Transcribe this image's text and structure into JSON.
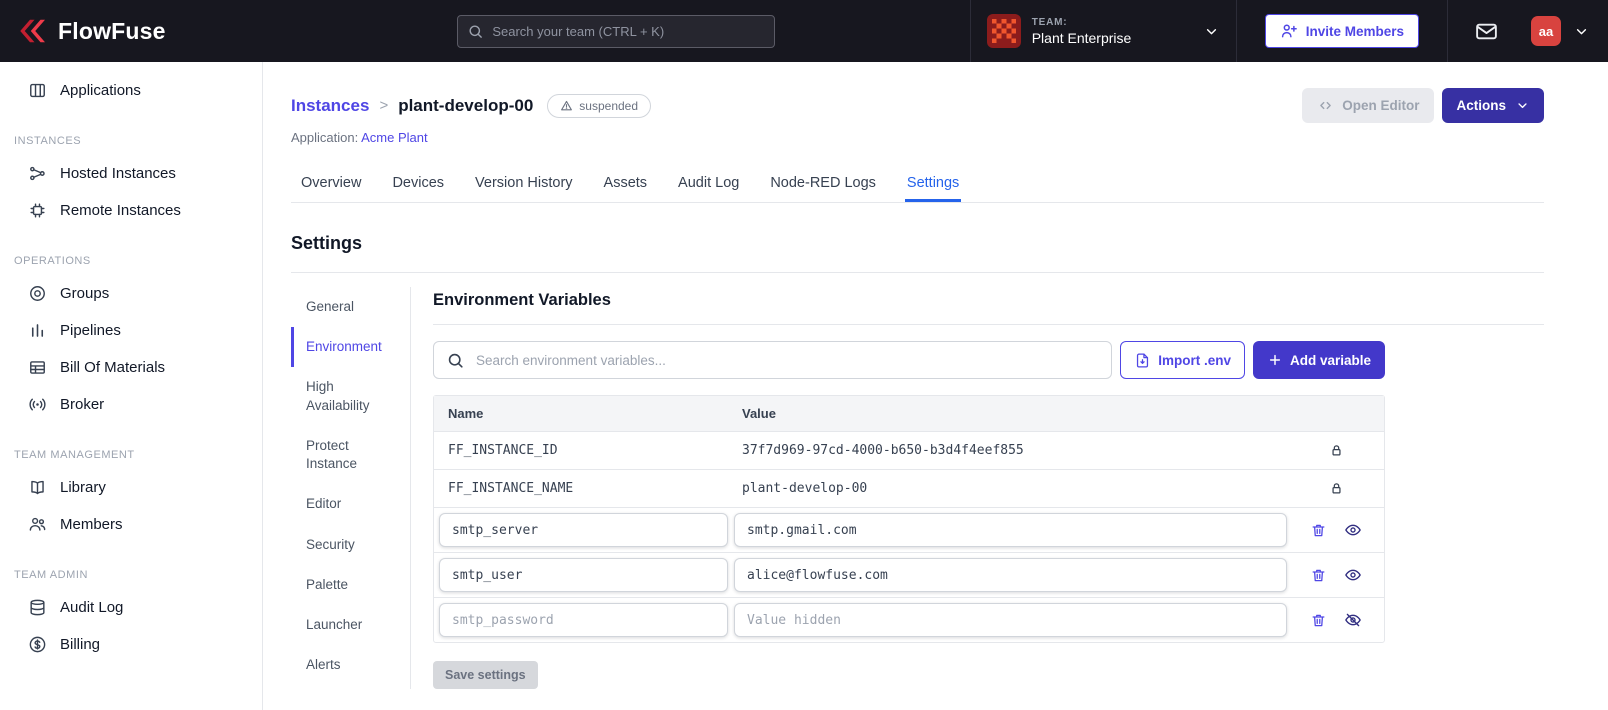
{
  "colors": {
    "brand_red": "#e5293a",
    "accent_indigo": "#4f46e5",
    "button_indigo_dark": "#3730a3",
    "active_tab_blue": "#2563eb",
    "navbar_bg": "#17171f"
  },
  "navbar": {
    "brand": "FlowFuse",
    "search_placeholder": "Search your team (CTRL + K)",
    "team_label": "TEAM:",
    "team_name": "Plant Enterprise",
    "invite_button": "Invite Members",
    "avatar_initials": "aa"
  },
  "sidebar": {
    "sections": [
      {
        "header": "",
        "items": [
          {
            "label": "Applications",
            "icon": "applications-icon"
          }
        ]
      },
      {
        "header": "INSTANCES",
        "items": [
          {
            "label": "Hosted Instances",
            "icon": "hosted-instances-icon"
          },
          {
            "label": "Remote Instances",
            "icon": "remote-instances-icon"
          }
        ]
      },
      {
        "header": "OPERATIONS",
        "items": [
          {
            "label": "Groups",
            "icon": "groups-icon"
          },
          {
            "label": "Pipelines",
            "icon": "pipelines-icon"
          },
          {
            "label": "Bill Of Materials",
            "icon": "bill-of-materials-icon"
          },
          {
            "label": "Broker",
            "icon": "broker-icon"
          }
        ]
      },
      {
        "header": "TEAM MANAGEMENT",
        "items": [
          {
            "label": "Library",
            "icon": "library-icon"
          },
          {
            "label": "Members",
            "icon": "members-icon"
          }
        ]
      },
      {
        "header": "TEAM ADMIN",
        "items": [
          {
            "label": "Audit Log",
            "icon": "audit-log-icon"
          },
          {
            "label": "Billing",
            "icon": "billing-icon"
          }
        ]
      }
    ]
  },
  "header": {
    "breadcrumb_parent": "Instances",
    "breadcrumb_separator": ">",
    "instance_name": "plant-develop-00",
    "status_badge": "suspended",
    "application_label": "Application:",
    "application_name": "Acme Plant",
    "open_editor_button": "Open Editor",
    "actions_button": "Actions"
  },
  "tabs": [
    {
      "label": "Overview",
      "active": false
    },
    {
      "label": "Devices",
      "active": false
    },
    {
      "label": "Version History",
      "active": false
    },
    {
      "label": "Assets",
      "active": false
    },
    {
      "label": "Audit Log",
      "active": false
    },
    {
      "label": "Node-RED Logs",
      "active": false
    },
    {
      "label": "Settings",
      "active": true
    }
  ],
  "settings": {
    "title": "Settings",
    "nav": [
      {
        "label": "General",
        "active": false
      },
      {
        "label": "Environment",
        "active": true
      },
      {
        "label": "High Availability",
        "active": false
      },
      {
        "label": "Protect Instance",
        "active": false
      },
      {
        "label": "Editor",
        "active": false
      },
      {
        "label": "Security",
        "active": false
      },
      {
        "label": "Palette",
        "active": false
      },
      {
        "label": "Launcher",
        "active": false
      },
      {
        "label": "Alerts",
        "active": false
      }
    ]
  },
  "environment": {
    "title": "Environment Variables",
    "search_placeholder": "Search environment variables...",
    "import_button": "Import .env",
    "add_button": "Add variable",
    "table": {
      "headers": {
        "name": "Name",
        "value": "Value"
      },
      "locked_rows": [
        {
          "name": "FF_INSTANCE_ID",
          "value": "37f7d969-97cd-4000-b650-b3d4f4eef855"
        },
        {
          "name": "FF_INSTANCE_NAME",
          "value": "plant-develop-00"
        }
      ],
      "editable_rows": [
        {
          "name": "smtp_server",
          "value": "smtp.gmail.com",
          "hidden": false
        },
        {
          "name": "smtp_user",
          "value": "alice@flowfuse.com",
          "hidden": false
        },
        {
          "name": "smtp_password",
          "value": "",
          "value_placeholder": "Value hidden",
          "hidden": true
        }
      ]
    },
    "save_button": "Save settings"
  }
}
